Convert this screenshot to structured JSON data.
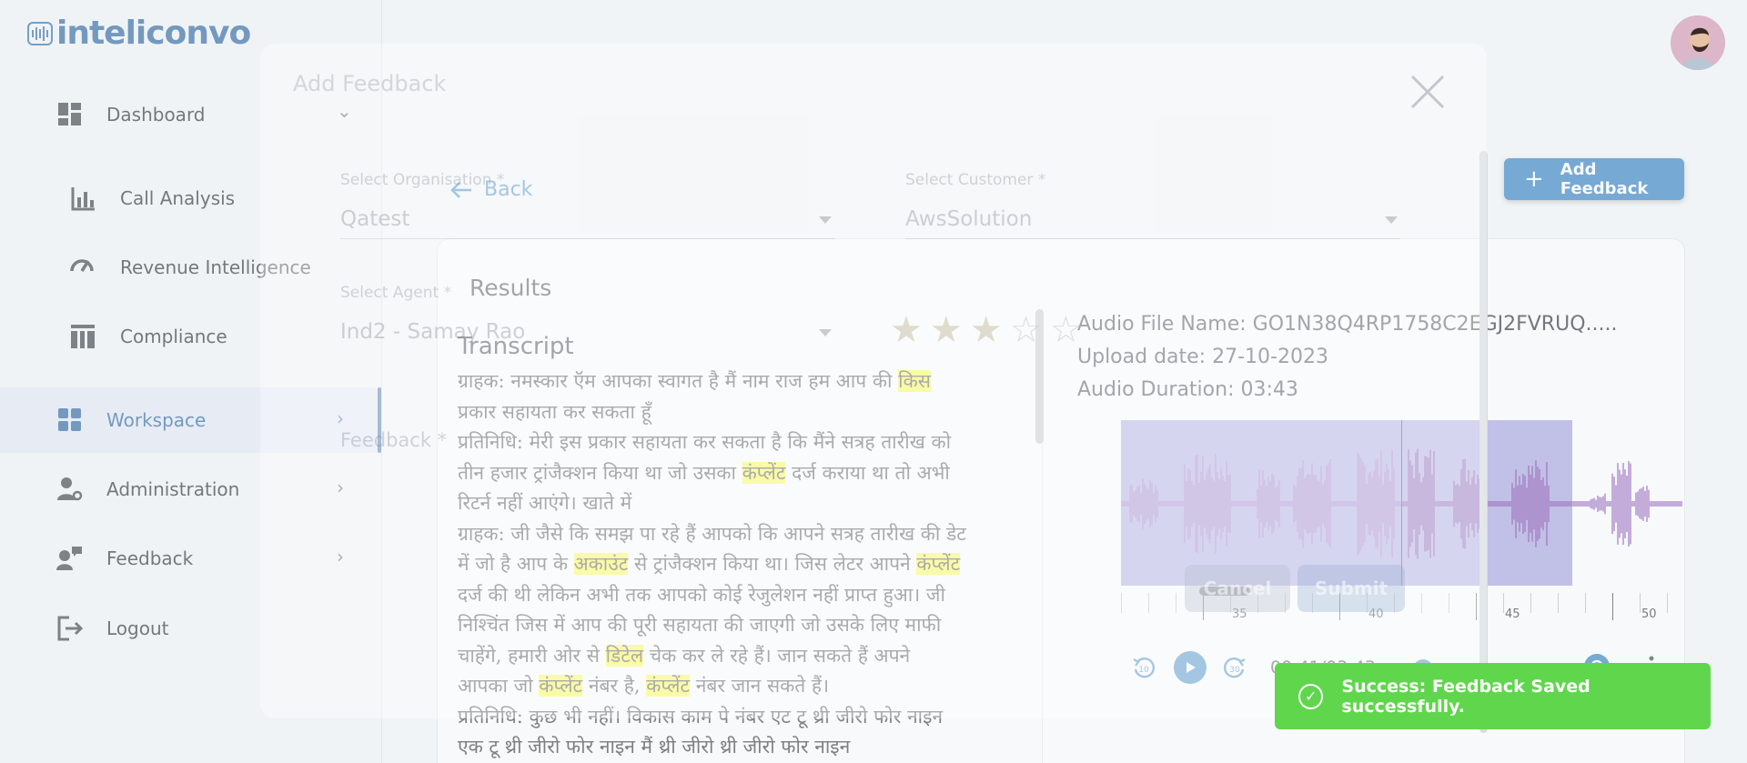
{
  "brand": {
    "name": "inteliconvo"
  },
  "sidebar": {
    "items": [
      {
        "label": "Dashboard",
        "icon": "dashboard-icon",
        "chevron": "⌄"
      },
      {
        "label": "Call Analysis",
        "icon": "bar-chart-icon"
      },
      {
        "label": "Revenue Intelligence",
        "icon": "speedometer-icon"
      },
      {
        "label": "Compliance",
        "icon": "compliance-icon"
      },
      {
        "label": "Workspace",
        "icon": "workspace-icon",
        "chevron": "›",
        "active": true
      },
      {
        "label": "Administration",
        "icon": "admin-icon",
        "chevron": "›"
      },
      {
        "label": "Feedback",
        "icon": "feedback-icon",
        "chevron": "›"
      },
      {
        "label": "Logout",
        "icon": "logout-icon"
      }
    ]
  },
  "main": {
    "add_feedback_label": "Add Feedback",
    "back_label": "Back",
    "results_title": "Results",
    "transcript": {
      "title": "Transcript",
      "lines": [
        "ग्राहक: नमस्कार ऍम आपका स्वागत है मैं नाम राज हम आप की ",
        "किस",
        "प्रकार सहायता कर सकता हूँ",
        "प्रतिनिधि: मेरी इस प्रकार सहायता कर सकता है कि मैंने सत्रह तारीख को",
        "तीन हजार ट्रांजैक्शन किया था जो उसका ",
        "कंप्लेंट",
        " दर्ज कराया था तो अभी",
        "रिटर्न नहीं आएंगे। खाते में",
        "ग्राहक: जी जैसे कि समझ पा रहे हैं आपको कि आपने सत्रह तारीख की डेट",
        "में जो है आप के ",
        "अकाउंट",
        " से ट्रांजैक्शन किया था। जिस लेटर आपने ",
        "कंप्लेंट",
        "दर्ज की थी लेकिन अभी तक आपको कोई रेजुलेशन नहीं प्राप्त हुआ। जी",
        "निश्चिंत जिस में आप की पूरी सहायता की जाएगी जो उसके लिए माफी",
        "चाहेंगे, हमारी ओर से ",
        "डिटेल",
        " चेक कर ले रहे हैं। जान सकते हैं अपने",
        "आपका जो ",
        "कंप्लेंट",
        " नंबर है, ",
        "कंप्लेंट",
        " नंबर जान सकते हैं।",
        "प्रतिनिधि: कुछ भी नहीं। विकास काम पे नंबर एट टू थ्री जीरो फोर नाइन",
        "एक टू थ्री जीरो फोर नाइन मैं थ्री जीरो थ्री जीरो फोर नाइन"
      ]
    },
    "audio": {
      "file_name": "Audio File Name: GO1N38Q4RP1758C2EGJ2FVRUQ.....",
      "upload_date": "Upload date: 27-10-2023",
      "duration": "Audio Duration: 03:43",
      "timeline_labels": [
        "35",
        "40",
        "45",
        "50"
      ],
      "current_time": "00:41/03:43",
      "progress_fraction": 0.18
    }
  },
  "modal": {
    "title": "Add Feedback",
    "org_label": "Select Organisation *",
    "org_value": "Qatest",
    "customer_label": "Select Customer *",
    "customer_value": "AwsSolution",
    "agent_label": "Select Agent *",
    "agent_value": "Ind2 - Samay Rao",
    "feedback_label": "Feedback *",
    "rating_stars": 3,
    "cancel_label": "Cancel",
    "submit_label": "Submit"
  },
  "toast": {
    "message": "Success: Feedback Saved successfully."
  },
  "colors": {
    "accent": "#2f7fc2",
    "success": "#5fd64c",
    "highlight": "#ffff2e",
    "waveform": "#8a4fb5"
  }
}
